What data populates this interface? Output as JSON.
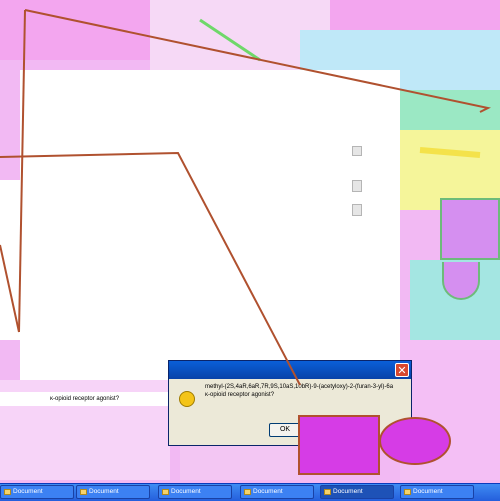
{
  "dialog": {
    "message_line1": "methyl-(2S,4aR,6aR,7R,9S,10aS,10bR)-9-(acetyloxy)-2-(furan-3-yl)-6a",
    "message_line2": "κ-opioid receptor agonist?",
    "ok_label": "OK",
    "close_glyph": "✕"
  },
  "background_text": "κ-opioid receptor agonist?",
  "taskbar": {
    "buttons": [
      {
        "label": "Document"
      },
      {
        "label": "Document"
      },
      {
        "label": "Document"
      },
      {
        "label": "Document"
      },
      {
        "label": "Document"
      },
      {
        "label": "Document"
      }
    ]
  },
  "colors": {
    "accent_line": "#b0512f",
    "magenta": "#d63ce6",
    "violet": "#d58ff0",
    "green_border": "#6dbb7a"
  }
}
